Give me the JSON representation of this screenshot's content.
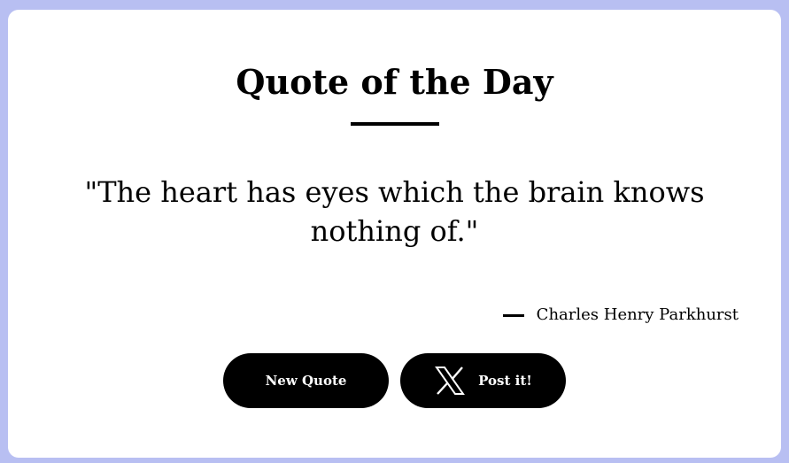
{
  "card": {
    "title": "Quote of the Day",
    "quote": "\"The heart has eyes which the brain knows nothing of.\"",
    "author": "Charles Henry Parkhurst"
  },
  "actions": {
    "new_quote_label": "New Quote",
    "post_label": "Post it!",
    "post_icon": "x-logo-icon"
  },
  "colors": {
    "background": "#b8bff2",
    "card": "#ffffff",
    "text": "#000000",
    "button": "#000000",
    "button_text": "#ffffff"
  }
}
